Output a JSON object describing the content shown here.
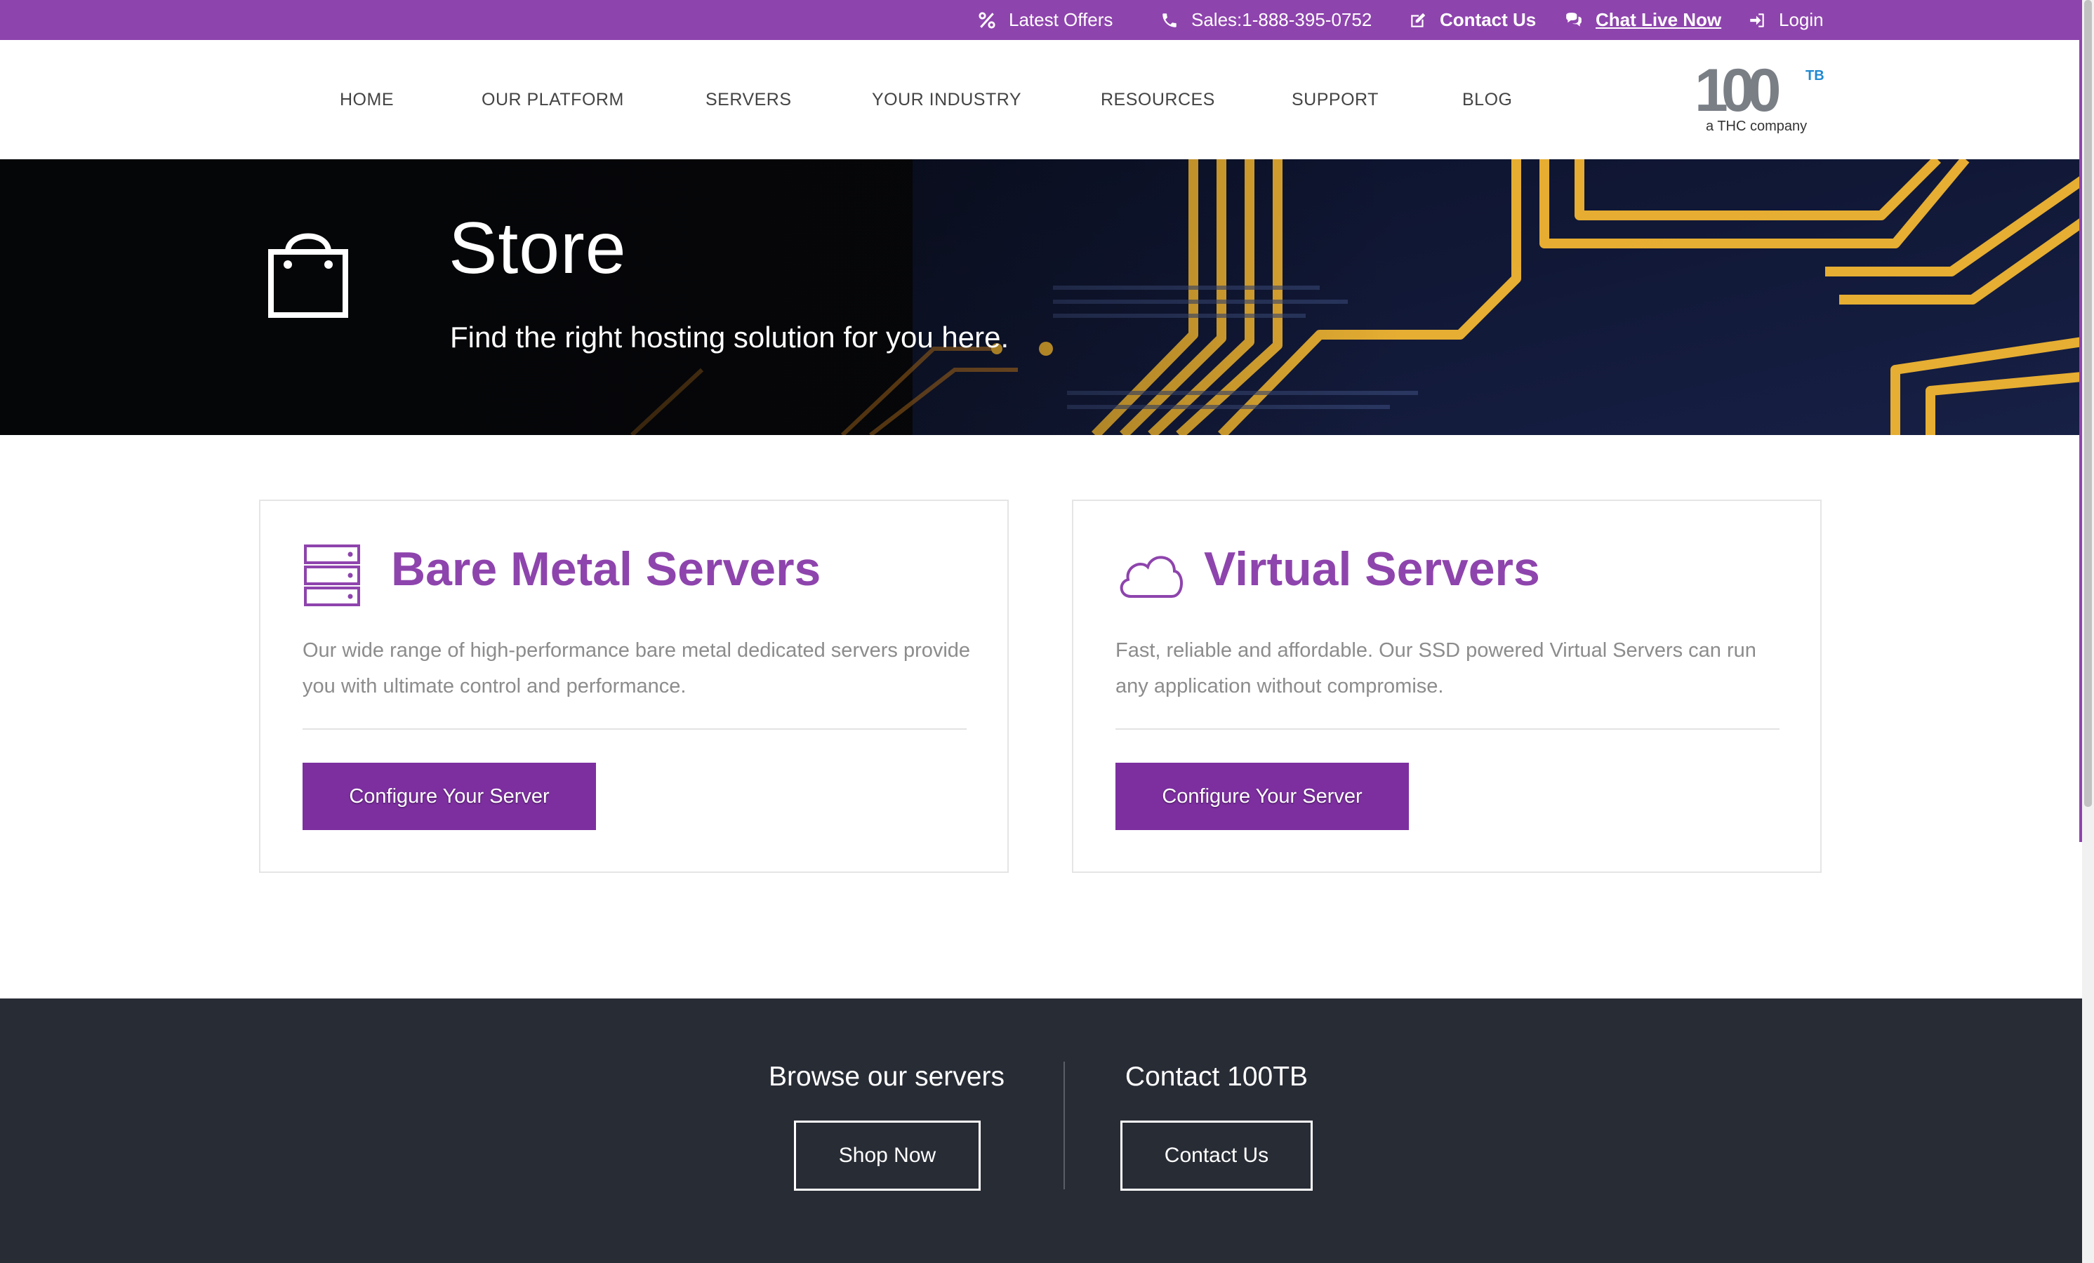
{
  "topbar": {
    "latest_offers": "Latest Offers",
    "sales": "Sales:1-888-395-0752",
    "contact_us": "Contact Us",
    "chat_live": "Chat Live Now",
    "login": "Login"
  },
  "nav": {
    "items": [
      "HOME",
      "OUR PLATFORM",
      "SERVERS",
      "YOUR INDUSTRY",
      "RESOURCES",
      "SUPPORT",
      "BLOG"
    ]
  },
  "logo": {
    "main": "100",
    "superscript": "TB",
    "tagline": "a THC company"
  },
  "hero": {
    "title": "Store",
    "subtitle": "Find the right hosting solution for you here."
  },
  "cards": [
    {
      "heading": "Bare Metal Servers",
      "description": "Our wide range of high-performance bare metal dedicated servers provide you with ultimate control and performance.",
      "button": "Configure Your Server",
      "icon": "server-stack-icon"
    },
    {
      "heading": "Virtual Servers",
      "description": "Fast, reliable and affordable. Our SSD powered Virtual Servers can run any application without compromise.",
      "button": "Configure Your Server",
      "icon": "cloud-icon"
    }
  ],
  "footer": {
    "browse_title": "Browse our servers",
    "browse_button": "Shop Now",
    "contact_title": "Contact 100TB",
    "contact_button": "Contact Us"
  },
  "colors": {
    "brand_purple": "#8e44ad",
    "button_purple": "#7d2fa0",
    "footer_bg": "#282c35",
    "logo_gray": "#7a7f86",
    "logo_blue": "#1f8ad2"
  }
}
